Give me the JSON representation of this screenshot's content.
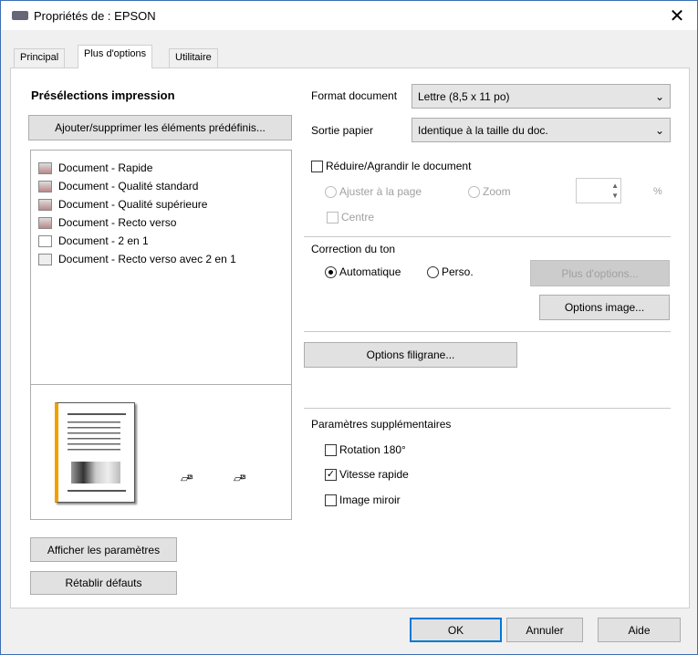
{
  "window": {
    "title": "Propriétés de : EPSON"
  },
  "tabs": [
    {
      "label": "Principal"
    },
    {
      "label": "Plus d'options"
    },
    {
      "label": "Utilitaire"
    }
  ],
  "presets": {
    "heading": "Présélections impression",
    "add_remove_label": "Ajouter/supprimer les éléments prédéfinis...",
    "items": [
      {
        "label": "Document - Rapide"
      },
      {
        "label": "Document - Qualité standard"
      },
      {
        "label": "Document - Qualité supérieure"
      },
      {
        "label": "Document - Recto verso"
      },
      {
        "label": "Document - 2 en 1"
      },
      {
        "label": "Document - Recto verso avec 2 en 1"
      }
    ]
  },
  "preview": {
    "accent": "#f0a000"
  },
  "left_buttons": {
    "show_settings": "Afficher les paramètres",
    "reset": "Rétablir défauts"
  },
  "format": {
    "label": "Format document",
    "value": "Lettre (8,5 x 11 po)"
  },
  "output": {
    "label": "Sortie papier",
    "value": "Identique à la taille du doc."
  },
  "reduce": {
    "label": "Réduire/Agrandir le document",
    "checked": false,
    "fit_label": "Ajuster à la page",
    "zoom_label": "Zoom",
    "zoom_value": "",
    "percent": "%",
    "center_label": "Centre"
  },
  "tone": {
    "label": "Correction du ton",
    "auto_label": "Automatique",
    "custom_label": "Perso.",
    "more_options": "Plus d'options...",
    "image_options": "Options image..."
  },
  "watermark": {
    "label": "Options filigrane..."
  },
  "extra": {
    "label": "Paramètres supplémentaires",
    "rotate": "Rotation 180°",
    "rotate_checked": false,
    "fast": "Vitesse rapide",
    "fast_checked": true,
    "mirror": "Image miroir",
    "mirror_checked": false
  },
  "footer": {
    "ok": "OK",
    "cancel": "Annuler",
    "help": "Aide"
  }
}
